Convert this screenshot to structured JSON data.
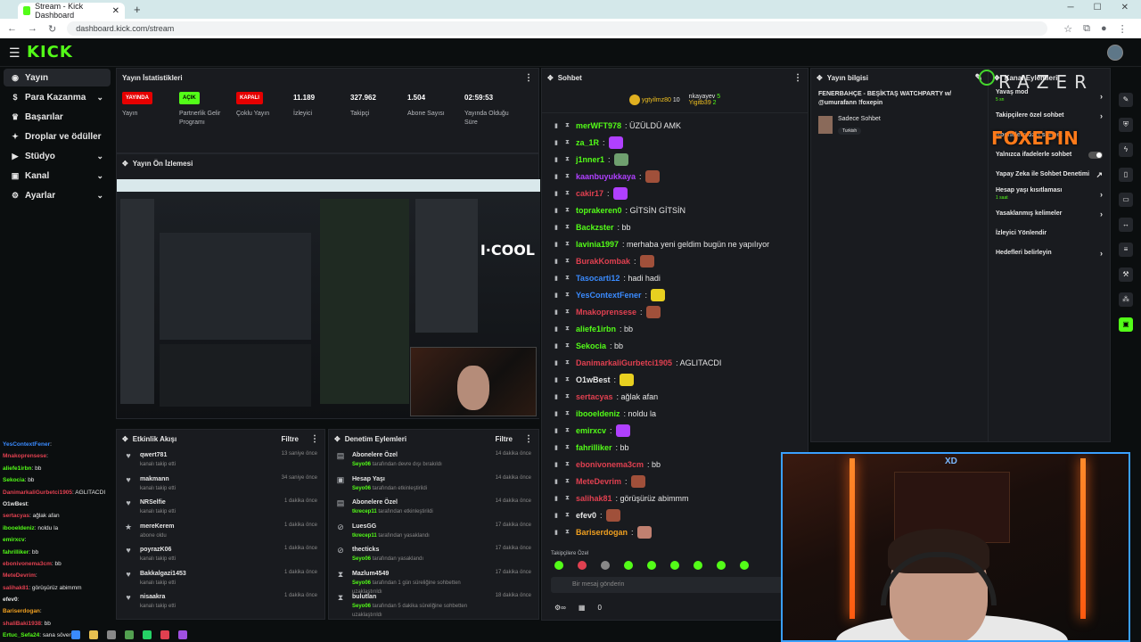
{
  "browser": {
    "tab_title": "Stream - Kick Dashboard",
    "new_tab": "+",
    "url": "dashboard.kick.com/stream",
    "win_min": "─",
    "win_max": "☐",
    "win_close": "✕"
  },
  "app": {
    "logo": "KICK"
  },
  "sidebar": {
    "items": [
      {
        "label": "Yayın",
        "icon": "broadcast-icon",
        "active": true,
        "chevron": false
      },
      {
        "label": "Para Kazanma",
        "icon": "money-icon",
        "active": false,
        "chevron": true
      },
      {
        "label": "Başarılar",
        "icon": "trophy-icon",
        "active": false,
        "chevron": false
      },
      {
        "label": "Droplar ve ödüller",
        "icon": "gift-icon",
        "active": false,
        "chevron": false
      },
      {
        "label": "Stüdyo",
        "icon": "studio-icon",
        "active": false,
        "chevron": true
      },
      {
        "label": "Kanal",
        "icon": "channel-icon",
        "active": false,
        "chevron": true
      },
      {
        "label": "Ayarlar",
        "icon": "gear-icon",
        "active": false,
        "chevron": true
      }
    ]
  },
  "stats": {
    "title": "Yayın İstatistikleri",
    "items": [
      {
        "value": "YAYINDA",
        "label": "Yayın",
        "kind": "red"
      },
      {
        "value": "AÇIK",
        "label": "Partnerlik Gelir Programı",
        "kind": "green"
      },
      {
        "value": "KAPALI",
        "label": "Çoklu Yayın",
        "kind": "red"
      },
      {
        "value": "11.189",
        "label": "İzleyici",
        "kind": "num"
      },
      {
        "value": "327.962",
        "label": "Takipçi",
        "kind": "num"
      },
      {
        "value": "1.504",
        "label": "Abone Sayısı",
        "kind": "num"
      },
      {
        "value": "02:59:53",
        "label": "Yayında Olduğu Süre",
        "kind": "num"
      }
    ]
  },
  "preview": {
    "title": "Yayın Ön İzlemesi",
    "cool_text": "I·COOL"
  },
  "activity": {
    "title": "Etkinlik Akışı",
    "filter": "Filtre",
    "items": [
      {
        "name": "qwert781",
        "sub": "kanalı takip etti",
        "time": "13 saniye önce",
        "icon": "♥"
      },
      {
        "name": "makmann",
        "sub": "kanalı takip etti",
        "time": "34 saniye önce",
        "icon": "♥"
      },
      {
        "name": "NRSelfie",
        "sub": "kanalı takip etti",
        "time": "1 dakika önce",
        "icon": "♥"
      },
      {
        "name": "mereKerem",
        "sub": "abone oldu",
        "time": "1 dakika önce",
        "icon": "★"
      },
      {
        "name": "poyrazK06",
        "sub": "kanalı takip etti",
        "time": "1 dakika önce",
        "icon": "♥"
      },
      {
        "name": "Bakkalgazi1453",
        "sub": "kanalı takip etti",
        "time": "1 dakika önce",
        "icon": "♥"
      },
      {
        "name": "nisaakra",
        "sub": "kanalı takip etti",
        "time": "1 dakika önce",
        "icon": "♥"
      }
    ]
  },
  "mod": {
    "title": "Denetim Eylemleri",
    "filter": "Filtre",
    "items": [
      {
        "name": "Abonelere Özel",
        "who": "Seyo06",
        "sub": "tarafından devre dışı bırakıldı",
        "time": "14 dakika önce",
        "icon": "▤"
      },
      {
        "name": "Hesap Yaşı",
        "who": "Seyo06",
        "sub": "tarafından etkinleştirildi",
        "time": "14 dakika önce",
        "icon": "▣"
      },
      {
        "name": "Abonelere Özel",
        "who": "tkrecep11",
        "sub": "tarafından etkinleştirildi",
        "time": "14 dakika önce",
        "icon": "▤"
      },
      {
        "name": "LuesGG",
        "who": "tkrecep11",
        "sub": "tarafından yasaklandı",
        "time": "17 dakika önce",
        "icon": "⊘"
      },
      {
        "name": "thecticks",
        "who": "Seyo06",
        "sub": "tarafından yasaklandı",
        "time": "17 dakika önce",
        "icon": "⊘"
      },
      {
        "name": "Mazlum4549",
        "who": "Seyo06",
        "sub": "tarafından 1 gün süreliğine sohbetten uzaklaştırıldı",
        "time": "17 dakika önce",
        "icon": "⧗"
      },
      {
        "name": "bulutlan",
        "who": "Seyo06",
        "sub": "tarafından 5 dakika süreliğine sohbetten uzaklaştırıldı",
        "time": "18 dakika önce",
        "icon": "⧗"
      }
    ]
  },
  "chat": {
    "title": "Sohbet",
    "top": [
      {
        "name": "ygtyilmz80",
        "count": "10"
      },
      {
        "name": "nkayayev",
        "count": "5"
      },
      {
        "name": "Yigitb39",
        "count": "2"
      }
    ],
    "messages": [
      {
        "user": "merWFT978",
        "color": "#53fc18",
        "text": ": ÜZÜLDÜ AMK",
        "emote": ""
      },
      {
        "user": "za_1R",
        "color": "#53fc18",
        "text": ":",
        "emote": "#b040ff"
      },
      {
        "user": "j1nner1",
        "color": "#53fc18",
        "text": ":",
        "emote": "#6fa06f"
      },
      {
        "user": "kaanbuyukkaya",
        "color": "#b040ff",
        "text": ":",
        "emote": "#a0503a"
      },
      {
        "user": "cakir17",
        "color": "#e04050",
        "text": ":",
        "emote": "#b040ff"
      },
      {
        "user": "toprakeren0",
        "color": "#53fc18",
        "text": ": GİTSİN GİTSİN",
        "emote": ""
      },
      {
        "user": "Backzster",
        "color": "#53fc18",
        "text": ": bb",
        "emote": ""
      },
      {
        "user": "lavinia1997",
        "color": "#53fc18",
        "text": ": merhaba yeni geldim bugün ne yapılıyor",
        "emote": ""
      },
      {
        "user": "BurakKombak",
        "color": "#e04050",
        "text": ":",
        "emote": "#a0503a"
      },
      {
        "user": "Tasocarti12",
        "color": "#3a8bff",
        "text": ": hadi hadi",
        "emote": ""
      },
      {
        "user": "YesContextFener",
        "color": "#3a8bff",
        "text": ":",
        "emote": "#e8d020"
      },
      {
        "user": "Mnakoprensese",
        "color": "#e04050",
        "text": ":",
        "emote": "#a0503a"
      },
      {
        "user": "aliefe1irbn",
        "color": "#53fc18",
        "text": ": bb",
        "emote": ""
      },
      {
        "user": "Sekocia",
        "color": "#53fc18",
        "text": ": bb",
        "emote": ""
      },
      {
        "user": "DanimarkaliGurbetci1905",
        "color": "#e04050",
        "text": ": AGLITACDI",
        "emote": ""
      },
      {
        "user": "O1wBest",
        "color": "#e6e6e6",
        "text": ":",
        "emote": "#e8d020"
      },
      {
        "user": "sertacyas",
        "color": "#e04050",
        "text": ": ağlak afan",
        "emote": ""
      },
      {
        "user": "ibooeldeniz",
        "color": "#53fc18",
        "text": ": noldu la",
        "emote": ""
      },
      {
        "user": "emirxcv",
        "color": "#53fc18",
        "text": ":",
        "emote": "#b040ff"
      },
      {
        "user": "fahrilliker",
        "color": "#53fc18",
        "text": ": bb",
        "emote": ""
      },
      {
        "user": "ebonivonema3cm",
        "color": "#e04050",
        "text": ": bb",
        "emote": ""
      },
      {
        "user": "MeteDevrim",
        "color": "#e04050",
        "text": ":",
        "emote": "#a0503a"
      },
      {
        "user": "salihak81",
        "color": "#e04050",
        "text": ": görüşürüz abimmm",
        "emote": ""
      },
      {
        "user": "efev0",
        "color": "#e6e6e6",
        "text": ":",
        "emote": "#a0503a"
      },
      {
        "user": "Bariserdogan",
        "color": "#f0a020",
        "text": ":",
        "emote": "#c08070"
      }
    ],
    "pinned_label": "Takipçilere Özel",
    "placeholder": "Bir mesaj gönderin",
    "viewers": "0"
  },
  "streaminfo": {
    "title": "Yayın bilgisi",
    "stream_title": "FENERBAHÇE - BEŞİKTAŞ WATCHPARTY w/ @umurafann !foxepin",
    "mode": "Sadece Sohbet",
    "tag": "Turkish"
  },
  "chatsettings": {
    "title": "Kanal Eylemleri",
    "items": [
      {
        "label": "Yavaş mod",
        "sub": "5 sn",
        "control": "arrow"
      },
      {
        "label": "Takipçilere özel sohbet",
        "sub": "",
        "control": "arrow"
      },
      {
        "label": "Abonelere özel sohbet",
        "sub": "",
        "control": "none"
      },
      {
        "label": "Yalnızca ifadelerle sohbet",
        "sub": "",
        "control": "toggle"
      },
      {
        "label": "Yapay Zeka ile Sohbet Denetimi",
        "sub": "",
        "control": "ext"
      },
      {
        "label": "Hesap yaşı kısıtlaması",
        "sub": "1 saat",
        "control": "arrow"
      },
      {
        "label": "Yasaklanmış kelimeler",
        "sub": "",
        "control": "arrow"
      },
      {
        "label": "İzleyici Yönlendir",
        "sub": "",
        "control": "none"
      },
      {
        "label": "Hedefleri belirleyin",
        "sub": "",
        "control": "arrow"
      }
    ]
  },
  "overlay": {
    "razer": "RAZER",
    "foxepin": "FOXEPIN",
    "webcam_badge": "XD"
  },
  "overlay_chat": [
    {
      "user": "YesContextFener",
      "color": "#3a8bff",
      "text": ":"
    },
    {
      "user": "Mnakoprensese",
      "color": "#e04050",
      "text": ":"
    },
    {
      "user": "aliefe1irbn",
      "color": "#53fc18",
      "text": ": bb"
    },
    {
      "user": "Sekocia",
      "color": "#53fc18",
      "text": ": bb"
    },
    {
      "user": "DanimarkaliGurbetci1905",
      "color": "#e04050",
      "text": ": AGLITACDI"
    },
    {
      "user": "O1wBest",
      "color": "#e6e6e6",
      "text": ":"
    },
    {
      "user": "sertacyas",
      "color": "#e04050",
      "text": ": ağlak afan"
    },
    {
      "user": "ibooeldeniz",
      "color": "#53fc18",
      "text": ": noldu la"
    },
    {
      "user": "emirxcv",
      "color": "#53fc18",
      "text": ":"
    },
    {
      "user": "fahrilliker",
      "color": "#53fc18",
      "text": ": bb"
    },
    {
      "user": "ebonivonema3cm",
      "color": "#e04050",
      "text": ": bb"
    },
    {
      "user": "MeteDevrim",
      "color": "#e04050",
      "text": ":"
    },
    {
      "user": "salihak81",
      "color": "#e04050",
      "text": ": görüşürüz abimmm"
    },
    {
      "user": "efev0",
      "color": "#e6e6e6",
      "text": ":"
    },
    {
      "user": "Bariserdogan",
      "color": "#f0a020",
      "text": ":"
    },
    {
      "user": "shaliBaki1938",
      "color": "#e04050",
      "text": ": bb"
    },
    {
      "user": "Ertuc_Sefa24",
      "color": "#53fc18",
      "text": ": sana söverim"
    }
  ],
  "colors": {
    "brand": "#53fc18",
    "live": "#e60000",
    "panel": "#191b1f"
  }
}
